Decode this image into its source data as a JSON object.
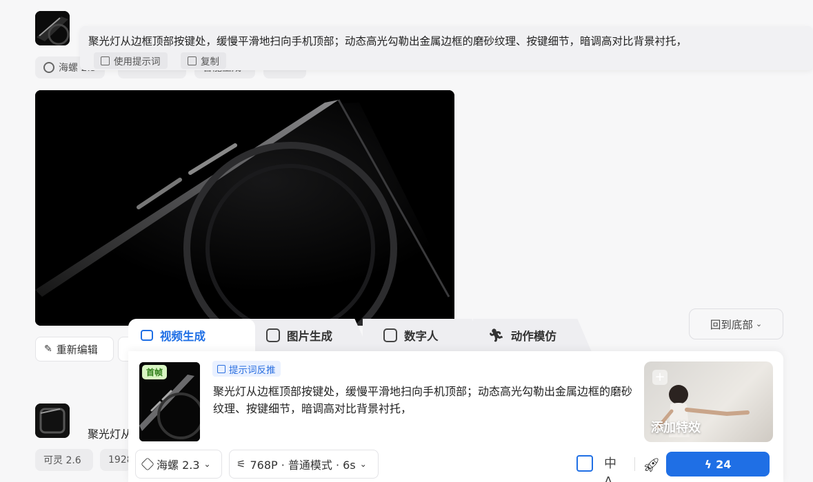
{
  "history_item_1": {
    "prompt_full": "聚光灯从边框顶部按键处，缓慢平滑地扫向手机顶部；动态高光勾勒出金属边框的磨砂纹理、按键细节，暗调高对比背景衬托，",
    "use_prompt_label": "使用提示词",
    "copy_label": "复制",
    "chips": [
      "海螺 2.3",
      "1080×1080",
      "智能生成",
      "6s"
    ],
    "actions": {
      "edit_label": "重新编辑"
    }
  },
  "history_item_2": {
    "prompt_snippet": "聚光灯从",
    "chips": [
      "可灵 2.6",
      "1928"
    ]
  },
  "back_to_bottom_label": "回到底部",
  "tabs": [
    {
      "label": "视频生成",
      "icon": "video-camera-icon",
      "active": true
    },
    {
      "label": "图片生成",
      "icon": "image-icon",
      "active": false
    },
    {
      "label": "数字人",
      "icon": "avatar-sparkle-icon",
      "active": false
    },
    {
      "label": "动作模仿",
      "icon": "running-person-icon",
      "active": false
    }
  ],
  "composer": {
    "first_frame_badge": "首帧",
    "reverse_prompt_label": "提示词反推",
    "prompt_text": "聚光灯从边框顶部按键处，缓慢平滑地扫向手机顶部；动态高光勾勒出金属边框的磨砂纹理、按键细节，暗调高对比背景衬托，",
    "add_effect_label": "添加特效",
    "model_select": "海螺 2.3",
    "settings_select": "768P · 普通模式 · 6s",
    "generate_cost": "24"
  },
  "colors": {
    "accent": "#1f6fe5",
    "badge_green": "#d9f5c3"
  }
}
